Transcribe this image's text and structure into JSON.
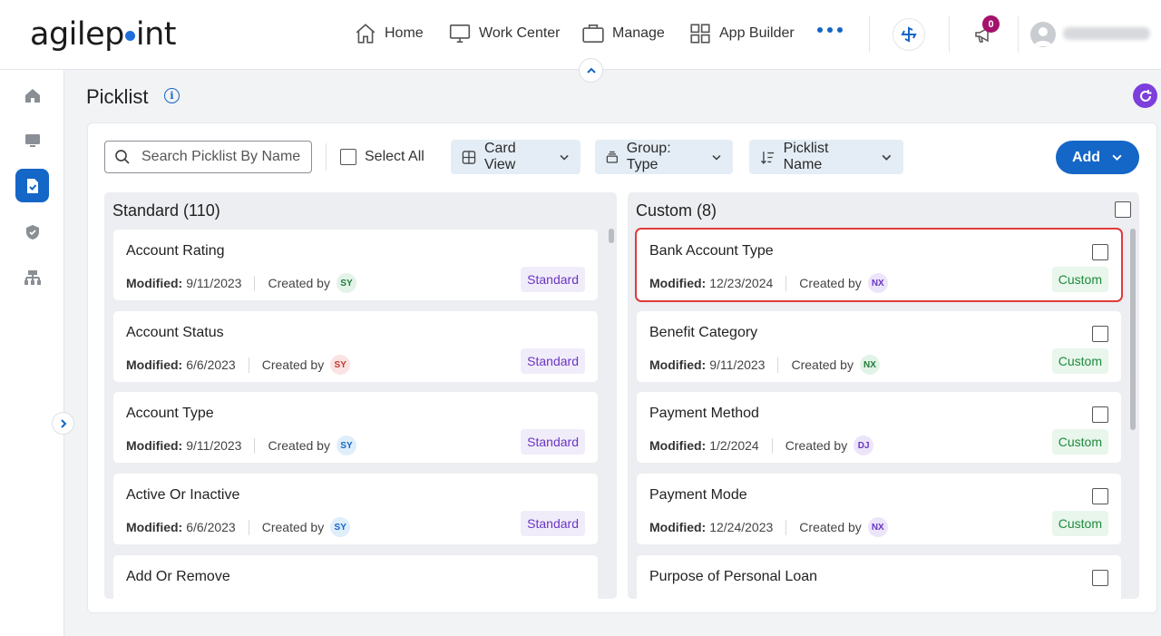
{
  "header": {
    "logo_text_1": "agilep",
    "logo_text_2": "int",
    "nav": [
      {
        "label": "Home",
        "icon": "home-icon"
      },
      {
        "label": "Work Center",
        "icon": "monitor-icon"
      },
      {
        "label": "Manage",
        "icon": "briefcase-icon"
      },
      {
        "label": "App Builder",
        "icon": "grid-icon"
      }
    ],
    "notification_count": "0"
  },
  "page": {
    "title": "Picklist",
    "info_glyph": "i"
  },
  "toolbar": {
    "search_placeholder": "Search Picklist By Name",
    "select_all_label": "Select All",
    "view_label": "Card View",
    "group_label": "Group: Type",
    "sort_label": "Picklist Name",
    "add_label": "Add"
  },
  "columns": {
    "standard": {
      "title": "Standard (110)",
      "cards": [
        {
          "name": "Account Rating",
          "modified_label": "Modified:",
          "modified": "9/11/2023",
          "created_by_label": "Created by",
          "initials": "SY",
          "type": "Standard"
        },
        {
          "name": "Account Status",
          "modified_label": "Modified:",
          "modified": "6/6/2023",
          "created_by_label": "Created by",
          "initials": "SY",
          "type": "Standard"
        },
        {
          "name": "Account Type",
          "modified_label": "Modified:",
          "modified": "9/11/2023",
          "created_by_label": "Created by",
          "initials": "SY",
          "type": "Standard"
        },
        {
          "name": "Active Or Inactive",
          "modified_label": "Modified:",
          "modified": "6/6/2023",
          "created_by_label": "Created by",
          "initials": "SY",
          "type": "Standard"
        },
        {
          "name": "Add Or Remove"
        }
      ]
    },
    "custom": {
      "title": "Custom (8)",
      "cards": [
        {
          "name": "Bank Account Type",
          "modified_label": "Modified:",
          "modified": "12/23/2024",
          "created_by_label": "Created by",
          "initials": "NX",
          "type": "Custom"
        },
        {
          "name": "Benefit Category",
          "modified_label": "Modified:",
          "modified": "9/11/2023",
          "created_by_label": "Created by",
          "initials": "NX",
          "type": "Custom"
        },
        {
          "name": "Payment Method",
          "modified_label": "Modified:",
          "modified": "1/2/2024",
          "created_by_label": "Created by",
          "initials": "DJ",
          "type": "Custom"
        },
        {
          "name": "Payment Mode",
          "modified_label": "Modified:",
          "modified": "12/24/2023",
          "created_by_label": "Created by",
          "initials": "NX",
          "type": "Custom"
        },
        {
          "name": "Purpose of Personal Loan"
        }
      ]
    }
  },
  "colors": {
    "accent": "#1466c7",
    "standard_badge": "#6a36c4",
    "custom_badge": "#1f8a3c",
    "highlight": "#e03b3b",
    "refresh": "#7d3fdc"
  }
}
